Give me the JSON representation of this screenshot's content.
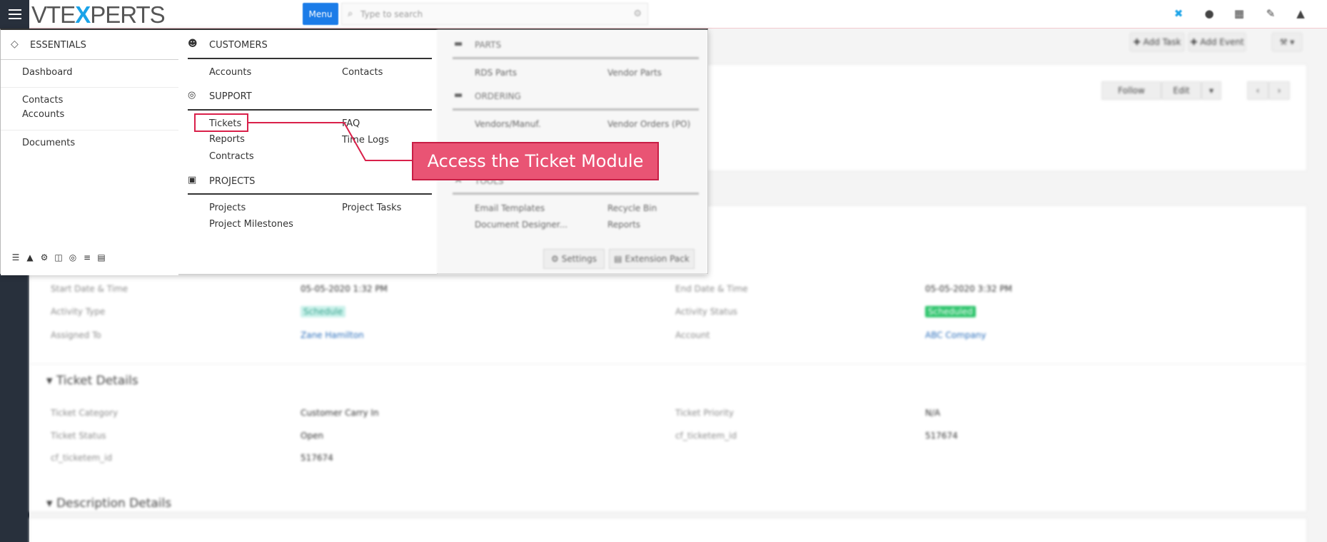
{
  "topbar": {
    "logo": {
      "vte": "VTE",
      "x": "X",
      "perts": "PERTS"
    },
    "menu_button": "Menu",
    "search_placeholder": "Type to search",
    "icons": [
      "app-switch-icon",
      "help-icon",
      "calendar-icon",
      "notes-icon",
      "user-icon"
    ]
  },
  "background": {
    "buttons": {
      "add_task": "Add Task",
      "add_event": "Add Event",
      "follow": "Follow",
      "edit": "Edit"
    },
    "fields": {
      "start_label": "Start Date & Time",
      "start_value": "05-05-2020 1:32 PM",
      "end_label": "End Date & Time",
      "end_value": "05-05-2020 3:32 PM",
      "type_label": "Activity Type",
      "type_value": "Schedule",
      "status_label": "Activity Status",
      "status_value": "Scheduled",
      "assigned_label": "Assigned To",
      "assigned_value": "Zane Hamilton",
      "account_label": "Account",
      "account_value": "ABC Company"
    },
    "ticket_panel": {
      "title": "Ticket Details",
      "category_label": "Ticket Category",
      "category_value": "Customer Carry In",
      "priority_label": "Ticket Priority",
      "priority_value": "N/A",
      "status_label": "Ticket Status",
      "status_value": "Open",
      "ticketid_label": "cf_ticketem_id",
      "ticketid_value": "517674",
      "ticketid2_label": "cf_ticketem_id",
      "ticketid2_value": "517674"
    },
    "description_panel": {
      "title": "Description Details"
    }
  },
  "menu": {
    "essentials": {
      "title": "ESSENTIALS",
      "items": [
        "Dashboard",
        "Contacts",
        "Accounts",
        "Documents"
      ]
    },
    "customers": {
      "title": "CUSTOMERS",
      "items": [
        "Accounts",
        "Contacts"
      ]
    },
    "support": {
      "title": "SUPPORT",
      "items": [
        "Tickets",
        "FAQ",
        "Reports",
        "Time Logs",
        "Contracts"
      ]
    },
    "projects": {
      "title": "PROJECTS",
      "items": [
        "Projects",
        "Project Tasks",
        "Project Milestones"
      ]
    },
    "parts": {
      "title": "PARTS",
      "items": [
        "RDS Parts",
        "Vendor Parts"
      ]
    },
    "ordering": {
      "title": "ORDERING",
      "items": [
        "Vendors/Manuf.",
        "Vendor Orders (PO)"
      ]
    },
    "tools": {
      "title": "TOOLS",
      "items": [
        "Email Templates",
        "Recycle Bin",
        "Document Designer...",
        "Reports"
      ]
    },
    "footer": {
      "settings": "Settings",
      "extension_pack": "Extension Pack"
    }
  },
  "annotation": {
    "callout": "Access the Ticket Module"
  }
}
